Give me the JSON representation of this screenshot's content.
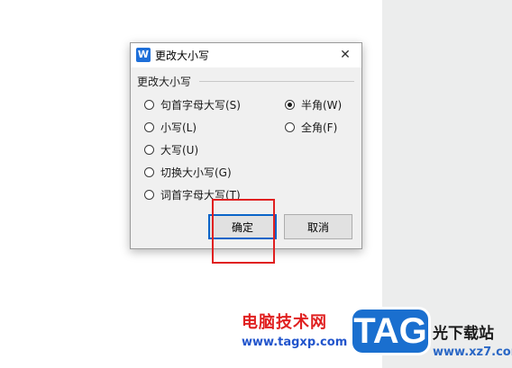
{
  "dialog": {
    "title": "更改大小写",
    "app_icon_letter": "W",
    "close_glyph": "✕",
    "group_label": "更改大小写",
    "left_options": [
      {
        "label": "句首字母大写(S)",
        "checked": false
      },
      {
        "label": "小写(L)",
        "checked": false
      },
      {
        "label": "大写(U)",
        "checked": false
      },
      {
        "label": "切换大小写(G)",
        "checked": false
      },
      {
        "label": "词首字母大写(T)",
        "checked": false
      }
    ],
    "right_options": [
      {
        "label": "半角(W)",
        "checked": true
      },
      {
        "label": "全角(F)",
        "checked": false
      }
    ],
    "ok_label": "确定",
    "cancel_label": "取消"
  },
  "watermark": {
    "site_cn": "电脑技术网",
    "url": "www.tagxp.com",
    "tag": "TAG",
    "site_cn_right": "光下载站",
    "url_right": "www.xz7.com"
  },
  "colors": {
    "highlight": "#e02020",
    "accent": "#0a64c8",
    "tag_blue": "#1a6fcf"
  }
}
